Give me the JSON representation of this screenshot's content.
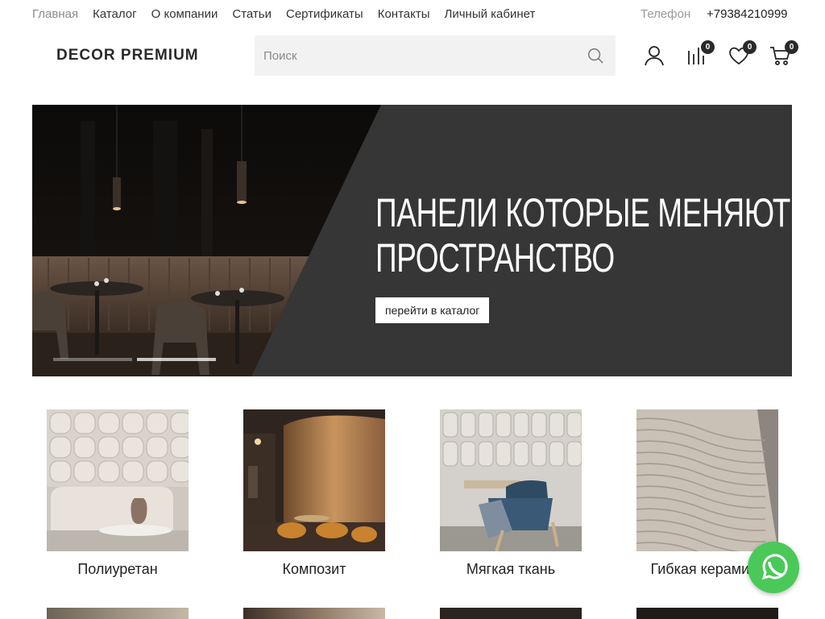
{
  "topnav": {
    "links": [
      "Главная",
      "Каталог",
      "О компании",
      "Статьи",
      "Сертификаты",
      "Контакты",
      "Личный кабинет"
    ],
    "phone_label": "Телефон",
    "phone": "+79384210999"
  },
  "header": {
    "logo": "DECOR PREMIUM",
    "search_placeholder": "Поиск",
    "icons": [
      "user-icon",
      "compare-icon",
      "heart-icon",
      "cart-icon"
    ],
    "compare_count": "0",
    "favorites_count": "0",
    "cart_count": "0"
  },
  "hero": {
    "title_line1": "Панели которые меняют",
    "title_line2": "пространство",
    "cta_label": "перейти в каталог",
    "slide_count": 2,
    "active_slide": 2
  },
  "categories": [
    {
      "label": "Полиуретан"
    },
    {
      "label": "Композит"
    },
    {
      "label": "Мягкая ткань"
    },
    {
      "label": "Гибкая керамика"
    }
  ],
  "colors": {
    "hero_bg": "#363636",
    "whatsapp": "#4ac959",
    "badge": "#2a2a2a"
  }
}
